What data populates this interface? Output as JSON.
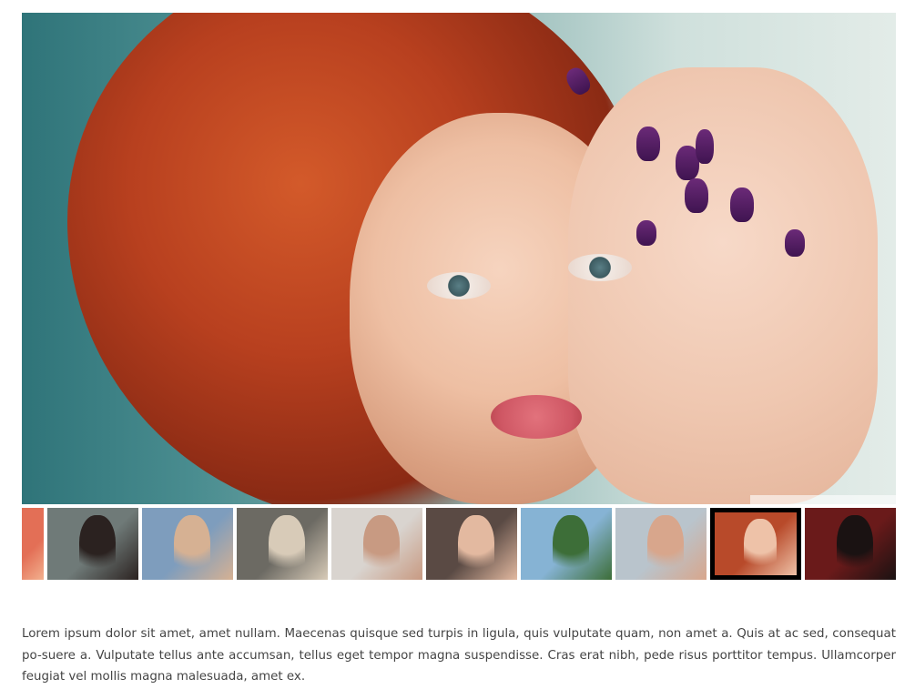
{
  "gallery": {
    "main_image": {
      "alt": "",
      "colors": {
        "background": "#4a8d90",
        "hair": "#b8401f",
        "skin": "#eebfa3",
        "nails": "#4f1c5e",
        "lips": "#cf5764"
      }
    },
    "thumbnails": [
      {
        "name": "thumb-partial",
        "active": false,
        "colors": [
          "#e36f56",
          "#f2b08e"
        ]
      },
      {
        "name": "thumb-1",
        "active": false,
        "colors": [
          "#6f7a78",
          "#2b2220"
        ]
      },
      {
        "name": "thumb-2",
        "active": false,
        "colors": [
          "#7e9dbd",
          "#d6b193"
        ]
      },
      {
        "name": "thumb-3",
        "active": false,
        "colors": [
          "#6c6a63",
          "#d8cbb8"
        ]
      },
      {
        "name": "thumb-4",
        "active": false,
        "colors": [
          "#d9d4cf",
          "#c89a82"
        ]
      },
      {
        "name": "thumb-5",
        "active": false,
        "colors": [
          "#5a4a44",
          "#e3b9a0"
        ]
      },
      {
        "name": "thumb-6",
        "active": false,
        "colors": [
          "#86b3d4",
          "#3d6e38"
        ]
      },
      {
        "name": "thumb-7",
        "active": false,
        "colors": [
          "#b9c4cc",
          "#d8a68c"
        ]
      },
      {
        "name": "thumb-8",
        "active": true,
        "colors": [
          "#b84a2a",
          "#eec2a8"
        ]
      },
      {
        "name": "thumb-9",
        "active": false,
        "colors": [
          "#6a1a1a",
          "#1a1212"
        ]
      }
    ],
    "active_border_color": "#000000"
  },
  "content": {
    "paragraph": "Lorem ipsum dolor sit amet, amet nullam. Maecenas quisque sed turpis in ligula, quis vulputate quam, non amet a. Quis at ac sed, consequat po-suere a. Vulputate tellus ante accumsan, tellus eget tempor magna suspendisse. Cras erat nibh, pede risus porttitor tempus. Ullamcorper feugiat vel mollis magna malesuada, amet ex."
  }
}
